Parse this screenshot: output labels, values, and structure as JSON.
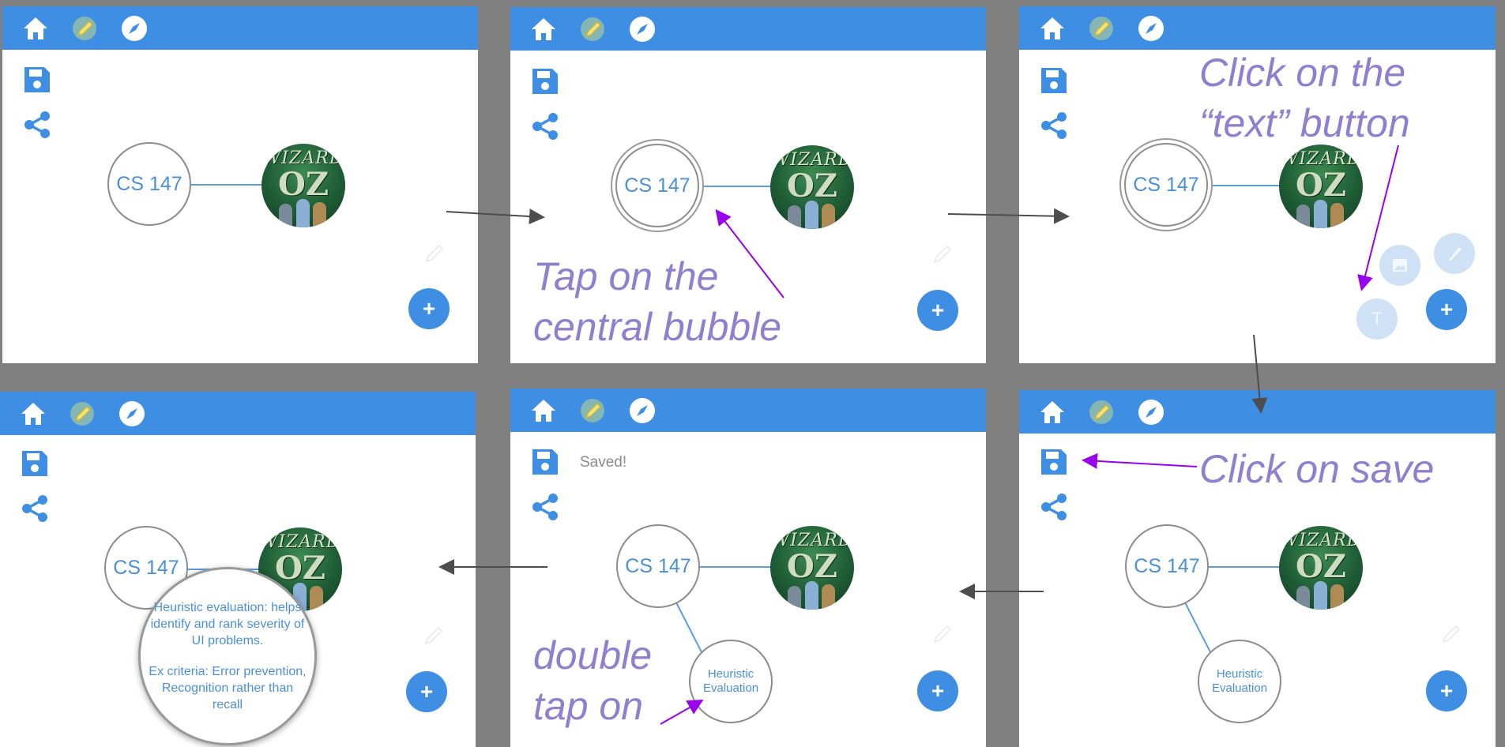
{
  "colors": {
    "topbar": "#3e8ee3",
    "link": "#5b9de0",
    "node_text": "#4a90d9",
    "annotation": "#8f7fcf",
    "arrow_purple": "#9900ee",
    "arrow_gray": "#4d4d4d",
    "background": "#808080"
  },
  "icons": [
    "home-icon",
    "pencil-icon",
    "compass-icon",
    "save-icon",
    "share-icon",
    "add-icon",
    "image-icon",
    "brush-icon",
    "text-icon"
  ],
  "steps": [
    {
      "central_label": "CS 147",
      "image_node": {
        "title": "WIZARD",
        "big": "OZ"
      },
      "add_label": "+"
    },
    {
      "central_label": "CS 147",
      "image_node": {
        "title": "WIZARD",
        "big": "OZ"
      },
      "add_label": "+"
    },
    {
      "central_label": "CS 147",
      "image_node": {
        "title": "WIZARD",
        "big": "OZ"
      },
      "add_label": "+",
      "text_button_label": "T"
    },
    {
      "central_label": "CS 147",
      "image_node": {
        "title": "WIZARD",
        "big": "OZ"
      },
      "add_label": "+",
      "child_label": "Heuristic Evaluation"
    },
    {
      "central_label": "CS 147",
      "image_node": {
        "title": "WIZARD",
        "big": "OZ"
      },
      "add_label": "+",
      "child_label": "Heuristic Evaluation",
      "saved_text": "Saved!"
    },
    {
      "central_label": "CS 147",
      "image_node": {
        "title": "WIZARD",
        "big": "OZ"
      },
      "add_label": "+",
      "expanded_text_1": "Heuristic evaluation: helps identify and rank severity of UI problems.",
      "expanded_text_2": "Ex criteria: Error prevention, Recognition rather than recall"
    }
  ],
  "annotations": {
    "tap_central_1": "Tap on the",
    "tap_central_2": "central bubble",
    "click_text_1": "Click on the",
    "click_text_2": "“text” button",
    "click_save": "Click on save",
    "double_tap_1": "double",
    "double_tap_2": "tap on"
  }
}
